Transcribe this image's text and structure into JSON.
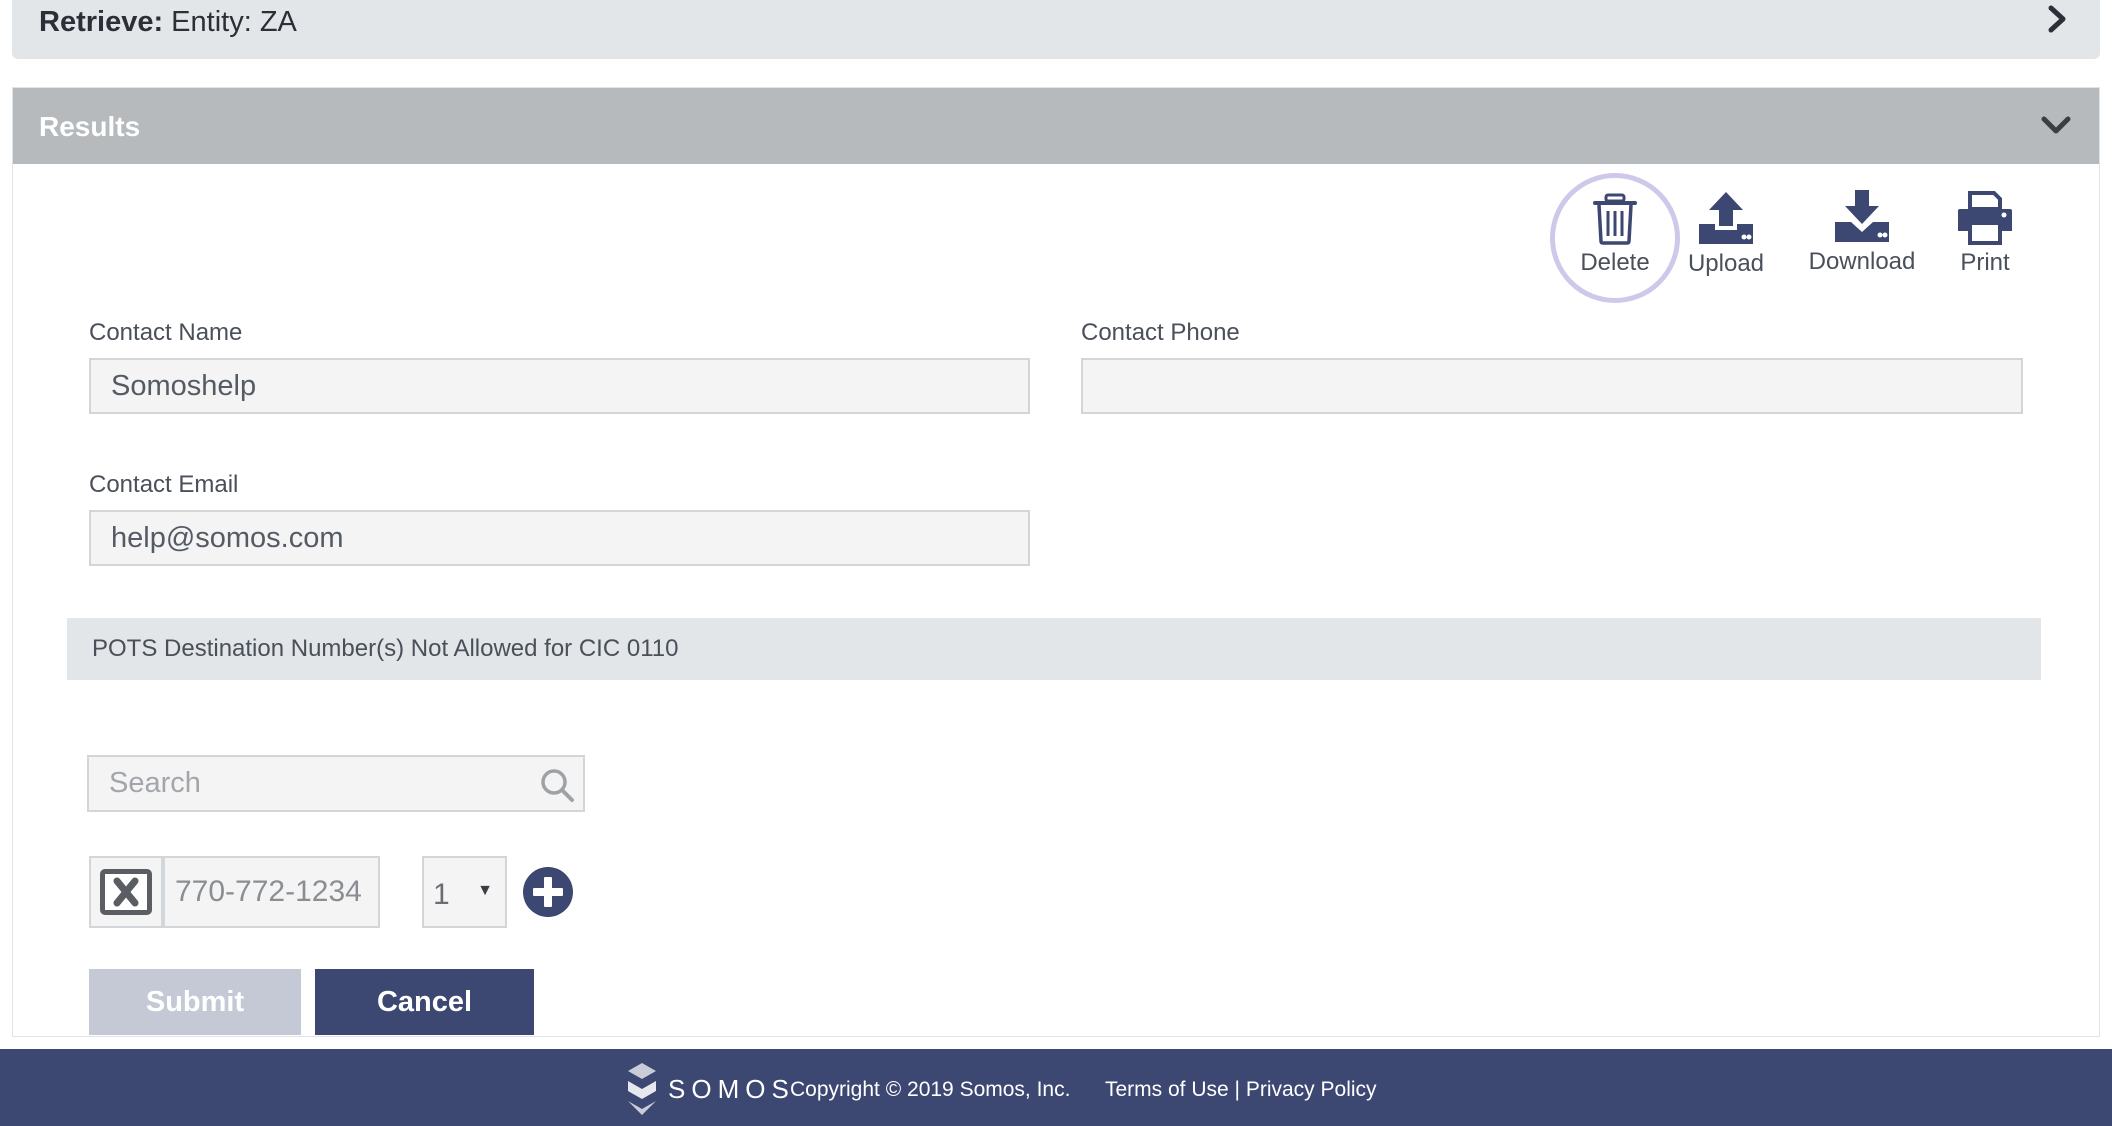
{
  "retrieve": {
    "label": "Retrieve:",
    "value": " Entity: ZA"
  },
  "results": {
    "title": "Results"
  },
  "toolbar": {
    "delete_label": "Delete",
    "upload_label": "Upload",
    "download_label": "Download",
    "print_label": "Print"
  },
  "form": {
    "contact_name_label": "Contact Name",
    "contact_name_value": "Somoshelp",
    "contact_phone_label": "Contact Phone",
    "contact_phone_value": "",
    "contact_email_label": "Contact Email",
    "contact_email_value": "help@somos.com"
  },
  "pots": {
    "message": "POTS Destination Number(s) Not Allowed for CIC 0110"
  },
  "search": {
    "placeholder": "Search"
  },
  "number_row": {
    "number": "770-772-1234",
    "quantity": "1"
  },
  "buttons": {
    "submit_label": "Submit",
    "cancel_label": "Cancel"
  },
  "footer": {
    "brand": "SOMOS",
    "copyright": "Copyright © 2019 Somos, Inc.",
    "terms_label": "Terms of Use",
    "separator": " | ",
    "privacy_label": "Privacy Policy"
  },
  "colors": {
    "primary_navy": "#3c4772",
    "header_gray": "#b6babd",
    "bar_gray": "#e3e6e8",
    "submit_disabled": "#c5c9d6",
    "highlight_ring": "#cfc8ea"
  },
  "icons": {
    "retrieve_toggle": "chevron-right-icon",
    "results_toggle": "chevron-down-icon",
    "delete": "trash-icon",
    "upload": "upload-icon",
    "download": "download-icon",
    "print": "printer-icon",
    "search": "search-icon",
    "remove": "close-box-icon",
    "add": "plus-circle-icon"
  }
}
